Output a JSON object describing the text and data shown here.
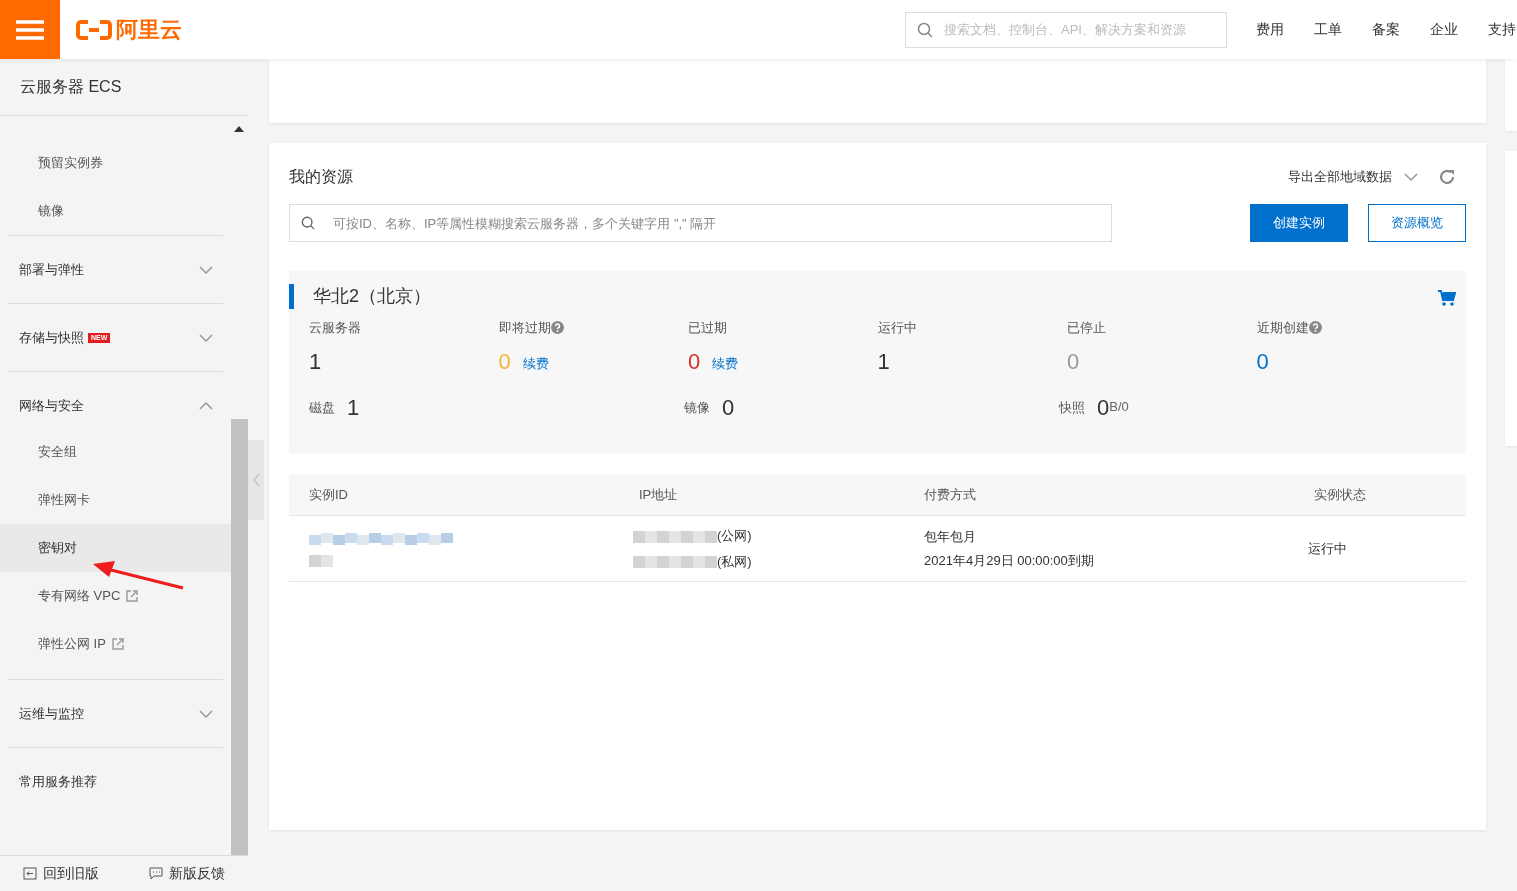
{
  "header": {
    "logo_text": "阿里云",
    "search": {
      "placeholder": "搜索文档、控制台、API、解决方案和资源"
    },
    "nav": [
      "费用",
      "工单",
      "备案",
      "企业",
      "支持"
    ]
  },
  "sidebar": {
    "title": "云服务器 ECS",
    "items": [
      {
        "kind": "item",
        "label": "预留实例券",
        "selected": false,
        "external": false
      },
      {
        "kind": "item",
        "label": "镜像",
        "selected": false,
        "external": false
      },
      {
        "kind": "group",
        "label": "部署与弹性",
        "expanded": false
      },
      {
        "kind": "group",
        "label": "存储与快照",
        "expanded": false,
        "badge": "NEW"
      },
      {
        "kind": "group",
        "label": "网络与安全",
        "expanded": true,
        "children": [
          {
            "kind": "item",
            "label": "安全组",
            "selected": false,
            "external": false
          },
          {
            "kind": "item",
            "label": "弹性网卡",
            "selected": false,
            "external": false
          },
          {
            "kind": "item",
            "label": "密钥对",
            "selected": true,
            "external": false
          },
          {
            "kind": "item",
            "label": "专有网络 VPC",
            "selected": false,
            "external": true
          },
          {
            "kind": "item",
            "label": "弹性公网 IP",
            "selected": false,
            "external": true
          }
        ]
      },
      {
        "kind": "group",
        "label": "运维与监控",
        "expanded": false
      },
      {
        "kind": "plain",
        "label": "常用服务推荐"
      }
    ],
    "footer": [
      "回到旧版",
      "新版反馈"
    ]
  },
  "resources": {
    "title": "我的资源",
    "export_label": "导出全部地域数据",
    "search": {
      "placeholder": "可按ID、名称、IP等属性模糊搜索云服务器，多个关键字用 \",\" 隔开"
    },
    "buttons": [
      {
        "label": "创建实例",
        "kind": "primary"
      },
      {
        "label": "资源概览",
        "kind": "outline"
      }
    ],
    "region": {
      "name": "华北2（北京）",
      "stats": [
        {
          "label": "云服务器",
          "value": "1",
          "color": "#333333",
          "help": false
        },
        {
          "label": "即将过期",
          "value": "0",
          "color": "#f5b433",
          "help": true,
          "action": "续费"
        },
        {
          "label": "已过期",
          "value": "0",
          "color": "#d93026",
          "help": false,
          "action": "续费"
        },
        {
          "label": "运行中",
          "value": "1",
          "color": "#333333",
          "help": false
        },
        {
          "label": "已停止",
          "value": "0",
          "color": "#999999",
          "help": false
        },
        {
          "label": "近期创建",
          "value": "0",
          "color": "#0070cc",
          "help": true
        }
      ],
      "totals": [
        {
          "label": "磁盘",
          "value": "1"
        },
        {
          "label": "镜像",
          "value": "0"
        },
        {
          "label": "快照",
          "value": "0",
          "unit": "B/0"
        }
      ]
    },
    "table": {
      "columns": [
        "实例ID",
        "IP地址",
        "付费方式",
        "实例状态"
      ],
      "rows": [
        {
          "public_ip": "(公网)",
          "private_ip": "(私网)",
          "billing": "包年包月",
          "expiry": "2021年4月29日 00:00:00到期",
          "status": "运行中"
        }
      ]
    }
  }
}
